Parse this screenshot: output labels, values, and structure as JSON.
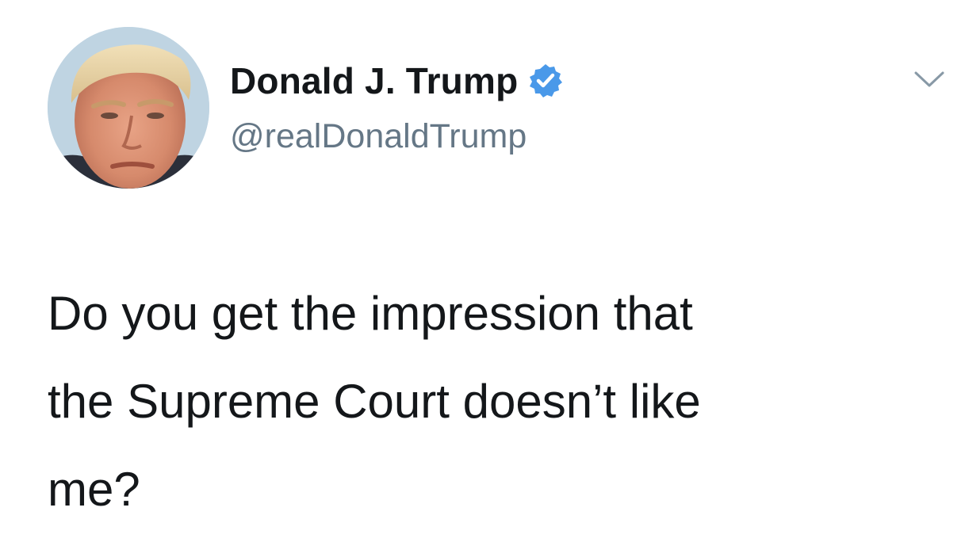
{
  "author": {
    "display_name": "Donald J. Trump",
    "handle": "@realDonaldTrump",
    "verified": true,
    "avatar_icon": "profile-photo",
    "verified_icon": "verified-badge-icon",
    "verified_color": "#4a99e9"
  },
  "menu": {
    "caret_icon": "chevron-down-icon"
  },
  "tweet": {
    "text_lines": [
      "Do you get the impression that",
      "the Supreme Court doesn’t like",
      "me?"
    ]
  },
  "colors": {
    "text_primary": "#14171a",
    "text_secondary": "#657786",
    "background": "#ffffff"
  }
}
